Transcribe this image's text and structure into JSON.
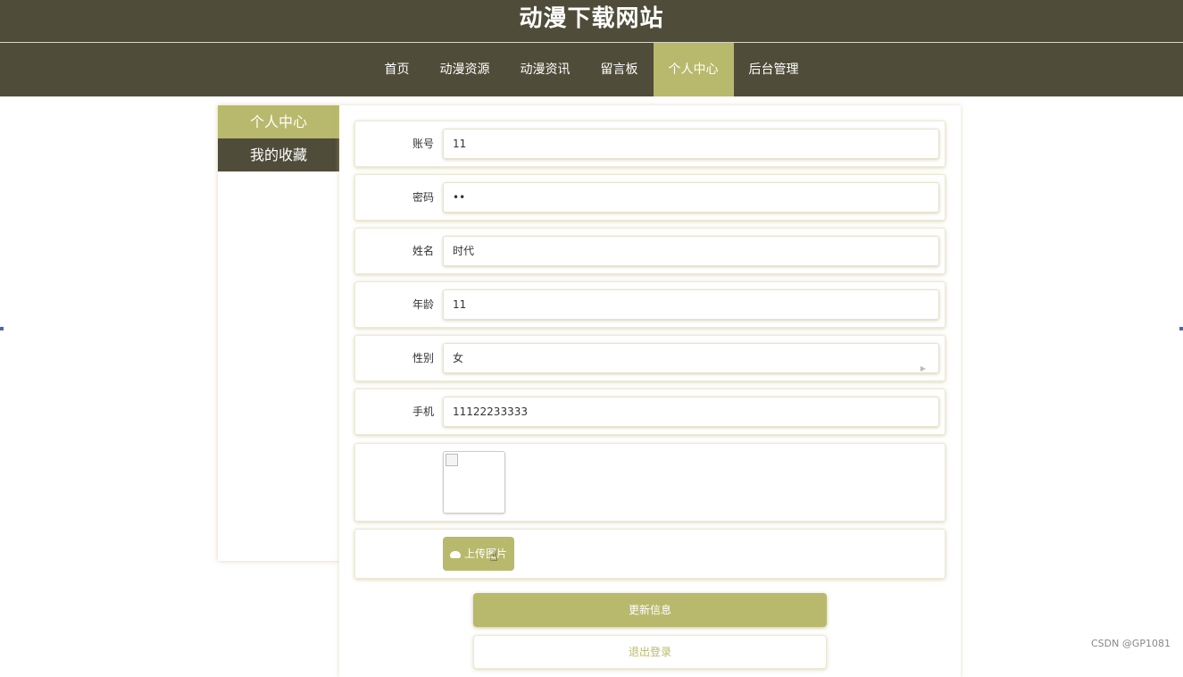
{
  "site": {
    "title": "动漫下载网站"
  },
  "nav": {
    "items": [
      {
        "label": "首页"
      },
      {
        "label": "动漫资源"
      },
      {
        "label": "动漫资讯"
      },
      {
        "label": "留言板"
      },
      {
        "label": "个人中心",
        "active": true
      },
      {
        "label": "后台管理"
      }
    ]
  },
  "sidebar": {
    "items": [
      {
        "label": "个人中心",
        "active": true
      },
      {
        "label": "我的收藏"
      }
    ]
  },
  "form": {
    "account": {
      "label": "账号",
      "value": "11"
    },
    "password": {
      "label": "密码",
      "value": "••"
    },
    "name": {
      "label": "姓名",
      "value": "时代"
    },
    "age": {
      "label": "年龄",
      "value": "11"
    },
    "gender": {
      "label": "性别",
      "value": "女"
    },
    "phone": {
      "label": "手机",
      "value": "11122233333"
    },
    "upload_label": "上传图片"
  },
  "actions": {
    "update_label": "更新信息",
    "logout_label": "退出登录"
  },
  "watermark": "CSDN @GP1081",
  "colors": {
    "header_bg": "#4f4c39",
    "accent": "#b8b96c"
  },
  "icons": [
    "cloud-upload-icon",
    "broken-image-icon",
    "hand-cursor-icon",
    "select-caret-icon"
  ]
}
